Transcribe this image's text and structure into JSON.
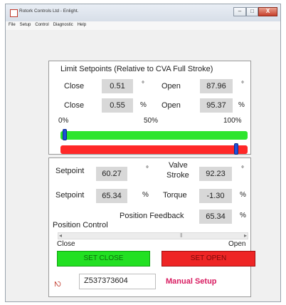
{
  "window": {
    "title": "Rotork Controls Ltd - Enlight.",
    "buttons": {
      "minimize": "–",
      "maximize": "□",
      "close": "X"
    }
  },
  "menu": [
    "File",
    "Setup",
    "Control",
    "Diagnostic",
    "Help"
  ],
  "limits": {
    "title": "Limit Setpoints (Relative to CVA Full Stroke)",
    "row1": {
      "close_label": "Close",
      "close_value": "0.51",
      "close_unit": "°",
      "open_label": "Open",
      "open_value": "87.96",
      "open_unit": "°"
    },
    "row2": {
      "close_label": "Close",
      "close_value": "0.55",
      "close_unit": "%",
      "open_label": "Open",
      "open_value": "95.37",
      "open_unit": "%"
    },
    "scale": {
      "min": "0%",
      "mid": "50%",
      "max": "100%"
    },
    "close_slider_fraction": 0.01,
    "open_slider_fraction": 0.95
  },
  "status": {
    "setpoint_deg_label": "Setpoint",
    "setpoint_deg_value": "60.27",
    "setpoint_deg_unit": "°",
    "valve_stroke_label_1": "Valve",
    "valve_stroke_label_2": "Stroke",
    "valve_stroke_value": "92.23",
    "valve_stroke_unit": "°",
    "setpoint_pct_label": "Setpoint",
    "setpoint_pct_value": "65.34",
    "setpoint_pct_unit": "%",
    "torque_label": "Torque",
    "torque_value": "-1.30",
    "torque_unit": "%",
    "feedback_label": "Position Feedback",
    "feedback_value": "65.34",
    "feedback_unit": "%"
  },
  "position_control": {
    "label": "Position Control",
    "left_arrow": "◂",
    "right_arrow": "▸",
    "thumb": "‖",
    "close_label": "Close",
    "open_label": "Open",
    "position_fraction": 0.65,
    "set_close": "SET CLOSE",
    "set_open": "SET OPEN"
  },
  "footer": {
    "logo_text": "ꩳ",
    "serial": "Z537373604",
    "mode": "Manual Setup"
  },
  "colors": {
    "green": "#2ee52e",
    "red": "#ff2828",
    "blue_thumb": "#1f4fd8",
    "manual_text": "#d81b60"
  }
}
